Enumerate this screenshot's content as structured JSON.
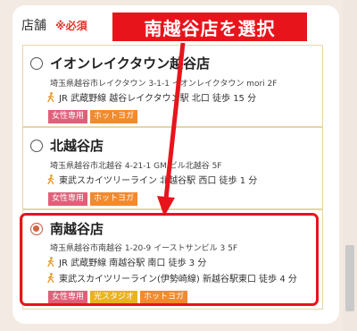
{
  "form": {
    "field_label": "店舗",
    "required_label": "※必須"
  },
  "stores": [
    {
      "name": "イオンレイクタウン越谷店",
      "address": "埼玉県越谷市レイクタウン 3-1-1 イオンレイクタウン mori 2F",
      "access": [
        "JR 武蔵野線 越谷レイクタウン駅 北口 徒歩 15 分"
      ],
      "tags": [
        "女性専用",
        "ホットヨガ"
      ],
      "selected": false
    },
    {
      "name": "北越谷店",
      "address": "埼玉県越谷市北越谷 4-21-1 GM ビル北越谷 5F",
      "access": [
        "東武スカイツリーライン 北越谷駅 西口 徒歩 1 分"
      ],
      "tags": [
        "女性専用",
        "ホットヨガ"
      ],
      "selected": false
    },
    {
      "name": "南越谷店",
      "address": "埼玉県越谷市南越谷 1-20-9 イーストサンビル 3 5F",
      "access": [
        "JR 武蔵野線 南越谷駅 南口 徒歩 3 分",
        "東武スカイツリーライン(伊勢崎線) 新越谷駅東口 徒歩 4 分"
      ],
      "tags": [
        "女性専用",
        "光スタジオ",
        "ホットヨガ"
      ],
      "selected": true
    }
  ],
  "annotation": {
    "text": "南越谷店を選択"
  },
  "colors": {
    "accent_red": "#e8141c",
    "tag_pink": "#e0607a",
    "tag_orange": "#f28a2e",
    "tag_yellow": "#e7b41f",
    "radio_selected": "#d2643f"
  }
}
